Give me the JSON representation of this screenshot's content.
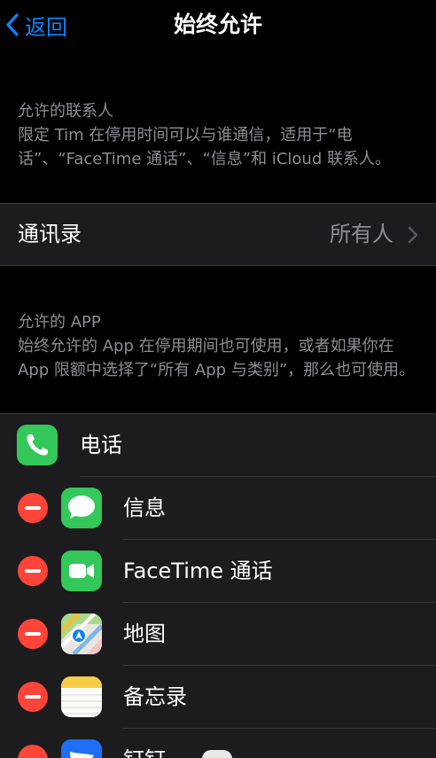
{
  "nav": {
    "back_label": "返回",
    "title": "始终允许"
  },
  "contacts_section": {
    "header": "允许的联系人",
    "description": "限定 Tim 在停用时间可以与谁通信，适用于“电话”、“FaceTime 通话”、“信息”和 iCloud 联系人。",
    "row": {
      "label": "通讯录",
      "value": "所有人"
    }
  },
  "apps_section": {
    "header": "允许的 APP",
    "description": "始终允许的 App 在停用期间也可使用，或者如果你在 App 限额中选择了“所有 App 与类别”，那么也可使用。",
    "apps": [
      {
        "label": "电话",
        "icon": "phone-icon",
        "removable": false
      },
      {
        "label": "信息",
        "icon": "messages-icon",
        "removable": true
      },
      {
        "label": "FaceTime 通话",
        "icon": "facetime-icon",
        "removable": true
      },
      {
        "label": "地图",
        "icon": "maps-icon",
        "removable": true
      },
      {
        "label": "备忘录",
        "icon": "notes-icon",
        "removable": true
      },
      {
        "label": "钉钉",
        "icon": "dingtalk-icon",
        "removable": true
      }
    ]
  },
  "colors": {
    "background": "#000000",
    "cell": "#1c1c1e",
    "accent": "#0a84ff",
    "secondary_text": "#8d8d93",
    "delete": "#ff453a",
    "green": "#34c759"
  }
}
